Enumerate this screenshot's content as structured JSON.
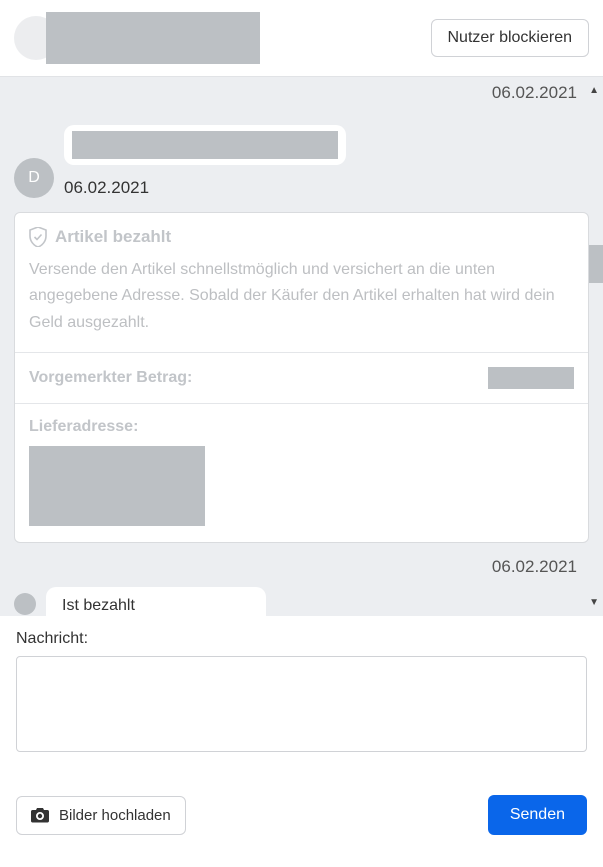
{
  "header": {
    "block_label": "Nutzer blockieren"
  },
  "chat": {
    "date_top": "06.02.2021",
    "avatar_initial": "D",
    "msg_date": "06.02.2021",
    "date_mid": "06.02.2021",
    "msg2_text": "Ist bezahlt"
  },
  "system_card": {
    "title": "Artikel bezahlt",
    "description": "Versende den Artikel schnellstmöglich und versichert an die unten angegebene Adresse. Sobald der Käufer den Artikel erhalten hat wird dein Geld ausgezahlt.",
    "amount_label": "Vorgemerkter Betrag:",
    "address_label": "Lieferadresse:"
  },
  "compose": {
    "label": "Nachricht:",
    "upload_label": "Bilder hochladen",
    "send_label": "Senden"
  }
}
